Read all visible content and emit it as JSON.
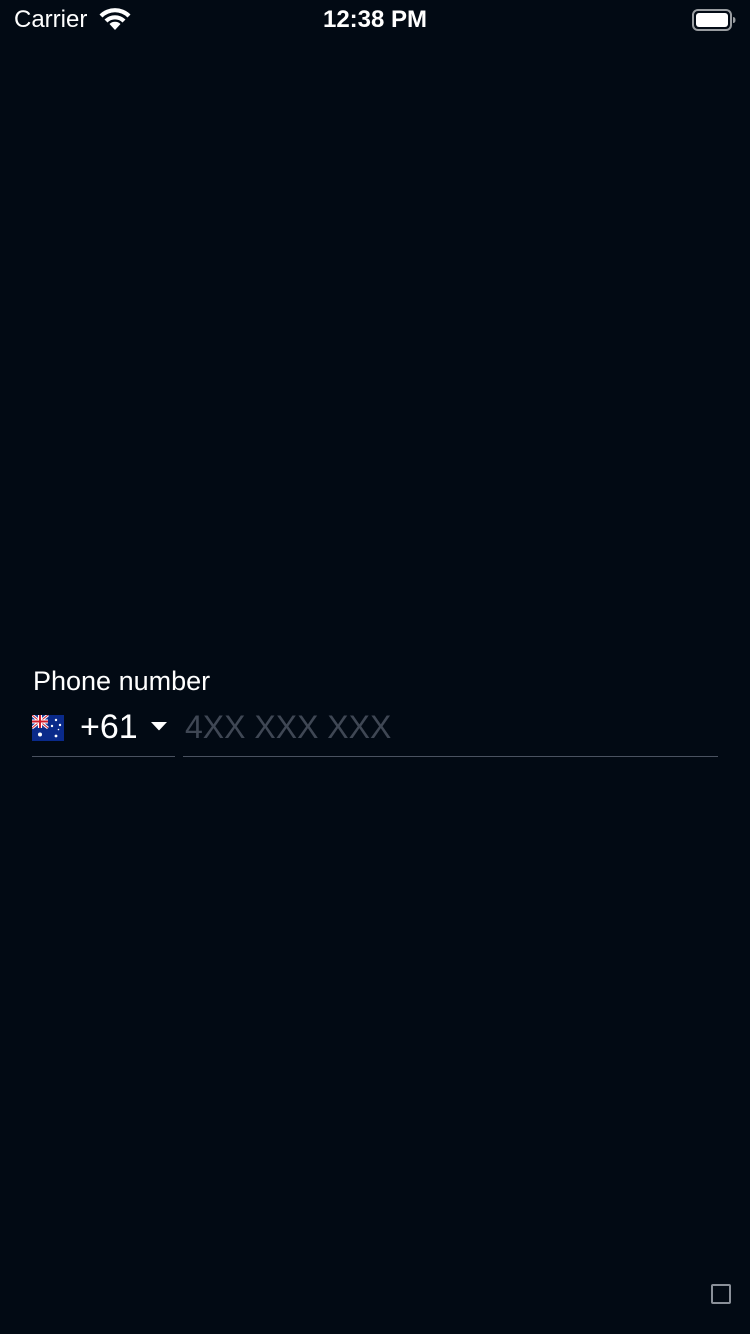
{
  "status_bar": {
    "carrier": "Carrier",
    "time": "12:38 PM",
    "wifi_icon": "wifi-icon",
    "battery_icon": "battery-icon"
  },
  "phone_input": {
    "label": "Phone number",
    "country": {
      "flag_icon": "australia-flag-icon",
      "dial_code": "+61",
      "dropdown_icon": "caret-down-icon"
    },
    "number": {
      "value": "",
      "placeholder": "4XX XXX XXX"
    }
  },
  "colors": {
    "background": "#020a14",
    "text": "#ffffff",
    "placeholder": "#3f4754",
    "underline": "#4a5260"
  }
}
